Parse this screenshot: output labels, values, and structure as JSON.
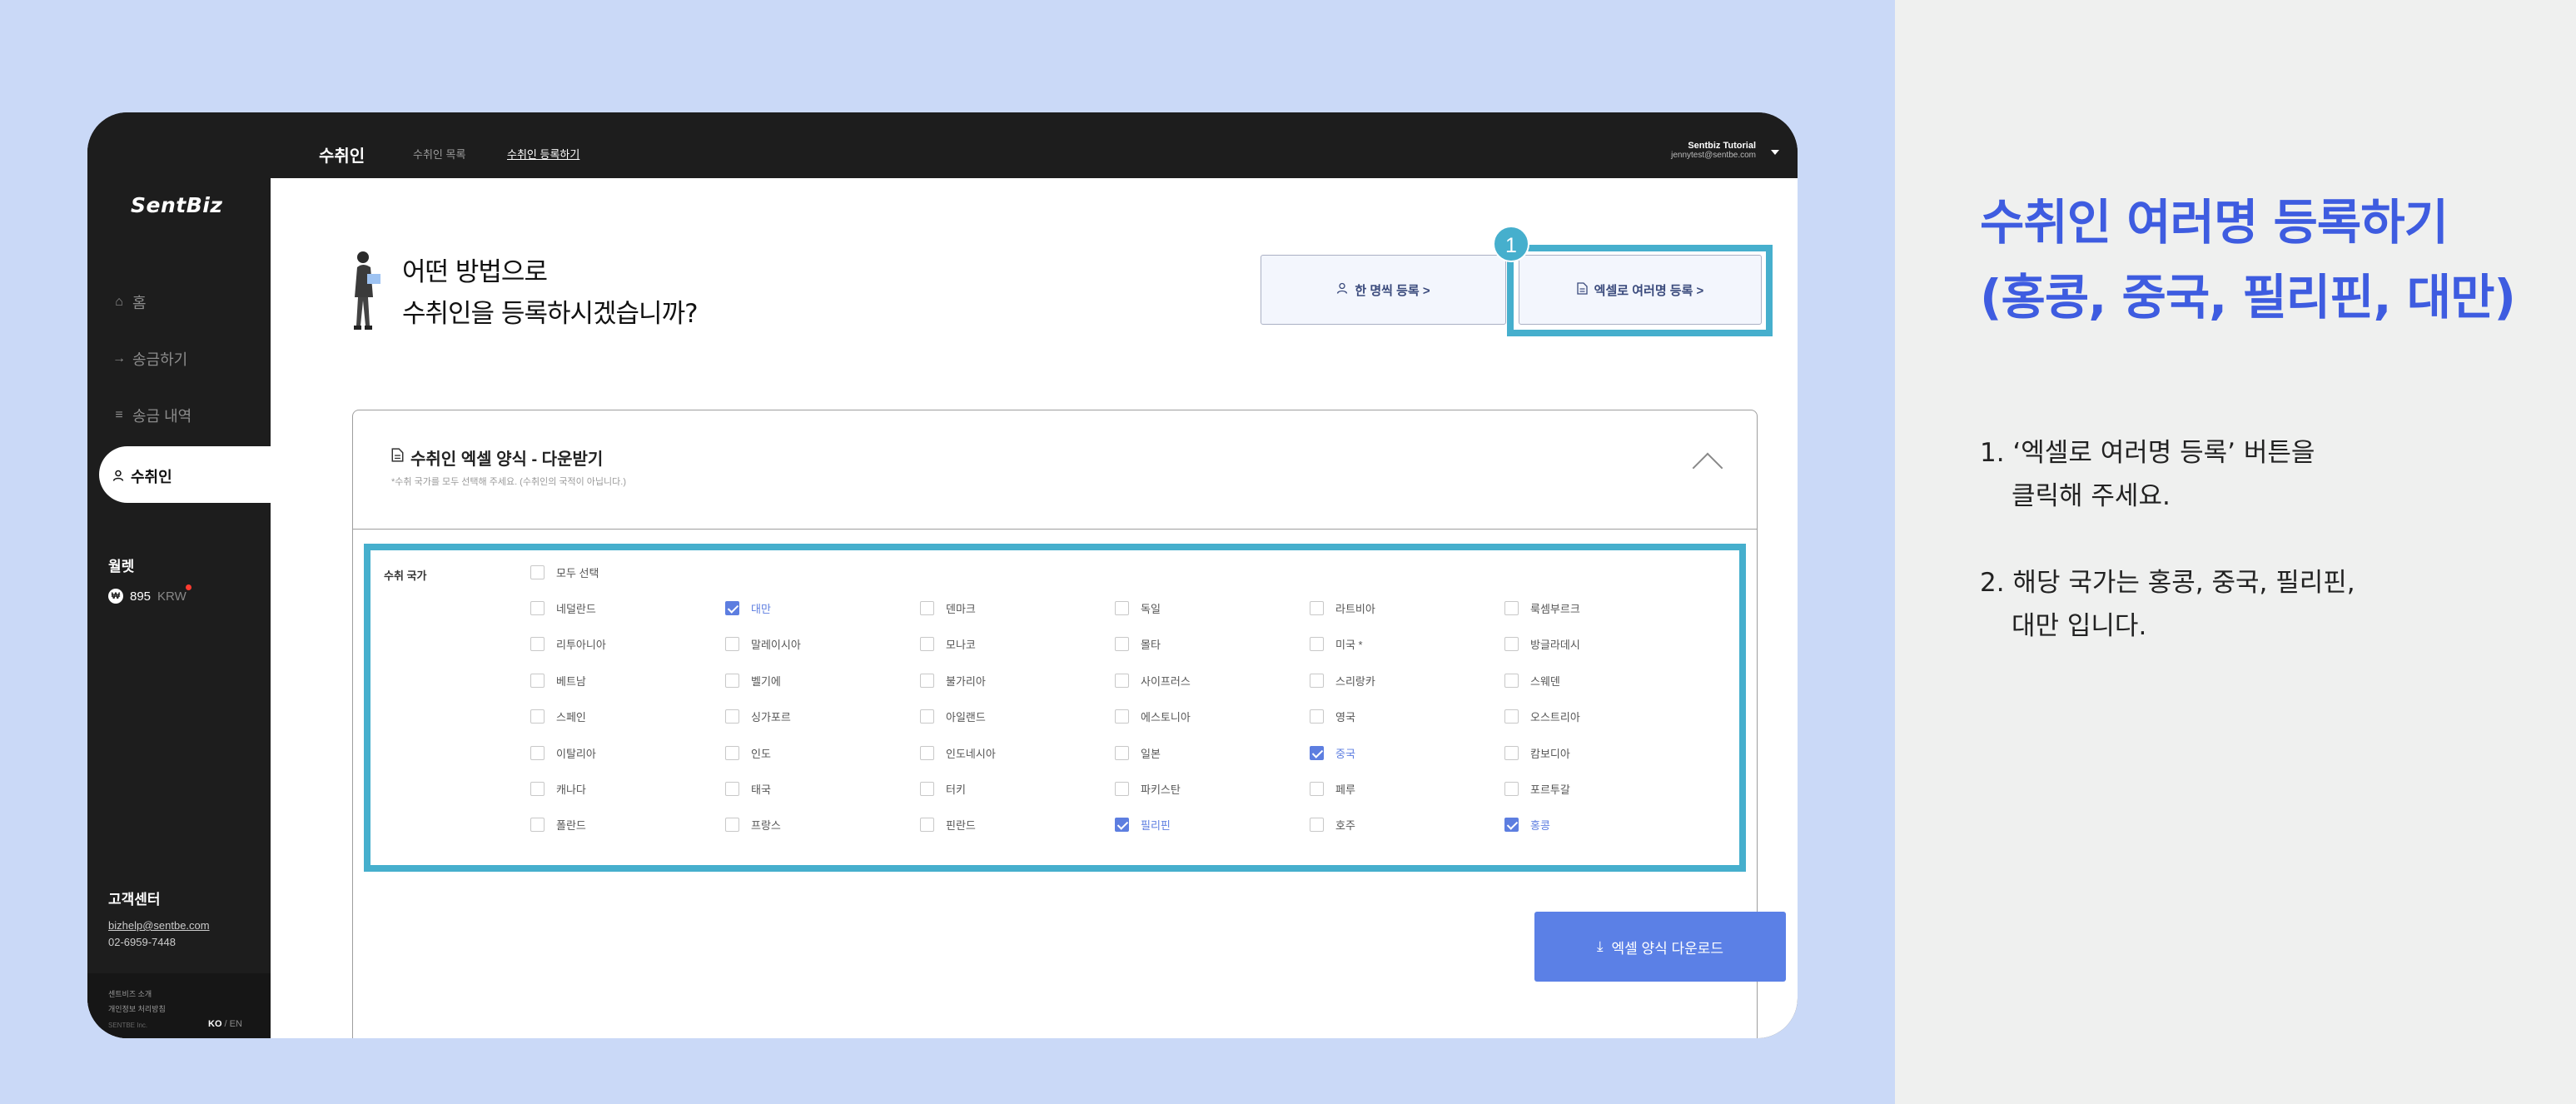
{
  "instruction": {
    "title_line1": "수취인 여러명 등록하기",
    "title_line2": "(홍콩, 중국, 필리핀, 대만)",
    "step1_line1": "1. ‘엑셀로 여러명 등록’ 버튼을",
    "step1_line2": "클릭해 주세요.",
    "step2_line1": "2. 해당 국가는 홍콩, 중국, 필리핀,",
    "step2_line2": "대만 입니다."
  },
  "topbar": {
    "title": "수취인",
    "link_list": "수취인 목록",
    "link_register": "수취인 등록하기",
    "user_name": "Sentbiz Tutorial",
    "user_email": "jennytest@sentbe.com"
  },
  "sidebar": {
    "logo": "SentBiz",
    "home": "홈",
    "send": "송금하기",
    "history": "송금 내역",
    "recipient": "수취인",
    "wallet_label": "월렛",
    "wallet_amount": "895",
    "wallet_unit": "KRW",
    "support_label": "고객센터",
    "support_email": "bizhelp@sentbe.com",
    "support_phone": "02-6959-7448",
    "footer_about": "센트비즈 소개",
    "footer_privacy": "개인정보 처리방침",
    "footer_corp": "SENTBE Inc.",
    "lang_ko": "KO",
    "lang_en": "EN"
  },
  "main": {
    "question_line1": "어떤 방법으로",
    "question_line2": "수취인을 등록하시겠습니까?",
    "btn_single": "한 명씩 등록 >",
    "btn_bulk": "엑셀로 여러명 등록 >",
    "badge": "1",
    "panel_title": "수취인 엑셀 양식 - 다운받기",
    "panel_sub": "*수취 국가를 모두 선택해 주세요. (수취인의 국적이 아닙니다.)",
    "country_label": "수취 국가",
    "select_all": "모두 선택",
    "download": "엑셀 양식 다운로드",
    "countries": [
      [
        "네덜란드",
        "대만",
        "덴마크",
        "독일",
        "라트비아",
        "룩셈부르크"
      ],
      [
        "리투아니아",
        "말레이시아",
        "모나코",
        "몰타",
        "미국 *",
        "방글라데시"
      ],
      [
        "베트남",
        "벨기에",
        "불가리아",
        "사이프러스",
        "스리랑카",
        "스웨덴"
      ],
      [
        "스페인",
        "싱가포르",
        "아일랜드",
        "에스토니아",
        "영국",
        "오스트리아"
      ],
      [
        "이탈리아",
        "인도",
        "인도네시아",
        "일본",
        "중국",
        "캄보디아"
      ],
      [
        "캐나다",
        "태국",
        "터키",
        "파키스탄",
        "페루",
        "포르투갈"
      ],
      [
        "폴란드",
        "프랑스",
        "핀란드",
        "필리핀",
        "호주",
        "홍콩"
      ]
    ],
    "checked": [
      "대만",
      "중국",
      "필리핀",
      "홍콩"
    ]
  }
}
